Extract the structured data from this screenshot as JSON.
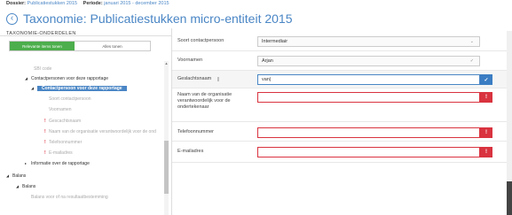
{
  "topbar": {
    "dossier_label": "Dossier:",
    "dossier_value": "Publicatiestukken 2015",
    "period_label": "Periode:",
    "period_value": "januari 2015 - december 2015"
  },
  "header": {
    "back_icon": "chevron-left-icon",
    "title": "Taxonomie: Publicatiestukken micro-entiteit 2015"
  },
  "section_title": "TAXONOMIE-ONDERDELEN",
  "toggle": {
    "on_label": "Relevante items tonen",
    "off_label": "Alles tonen"
  },
  "tree": {
    "items": [
      {
        "label": "SBI code"
      },
      {
        "label": "Contactpersonen voor deze rapportage"
      },
      {
        "label": "Contactpersoon voor deze rapportage"
      },
      {
        "label": "Soort contactpersoon"
      },
      {
        "label": "Voornamen"
      },
      {
        "label": "Gescachtsnaam"
      },
      {
        "label": "Naam van de organisatie verantwoordelijk voor de ond"
      },
      {
        "label": "Telefoonnummer"
      },
      {
        "label": "E-mailadres"
      },
      {
        "label": "Informatie over de rapportage"
      },
      {
        "label": "Balans"
      },
      {
        "label": "Balans"
      },
      {
        "label": "Balans voor of na resultaatbestemming"
      }
    ]
  },
  "form": {
    "fields": [
      {
        "label": "Soort contactpersoon",
        "value": "Intermediair"
      },
      {
        "label": "Voornamen",
        "value": "Arjan"
      },
      {
        "label": "Geslachtsnaam",
        "value": "van|"
      },
      {
        "label": "Naam van de organisatie verantwoordelijk voor de ondertekenaar",
        "value": ""
      },
      {
        "label": "Telefoonnummer",
        "value": ""
      },
      {
        "label": "E-mailadres",
        "value": ""
      }
    ],
    "confirm_icon": "check-icon",
    "error_icon": "exclamation-icon"
  },
  "colors": {
    "accent": "#4a86c5",
    "toggle_on": "#4cae4c",
    "error": "#d9333f"
  }
}
